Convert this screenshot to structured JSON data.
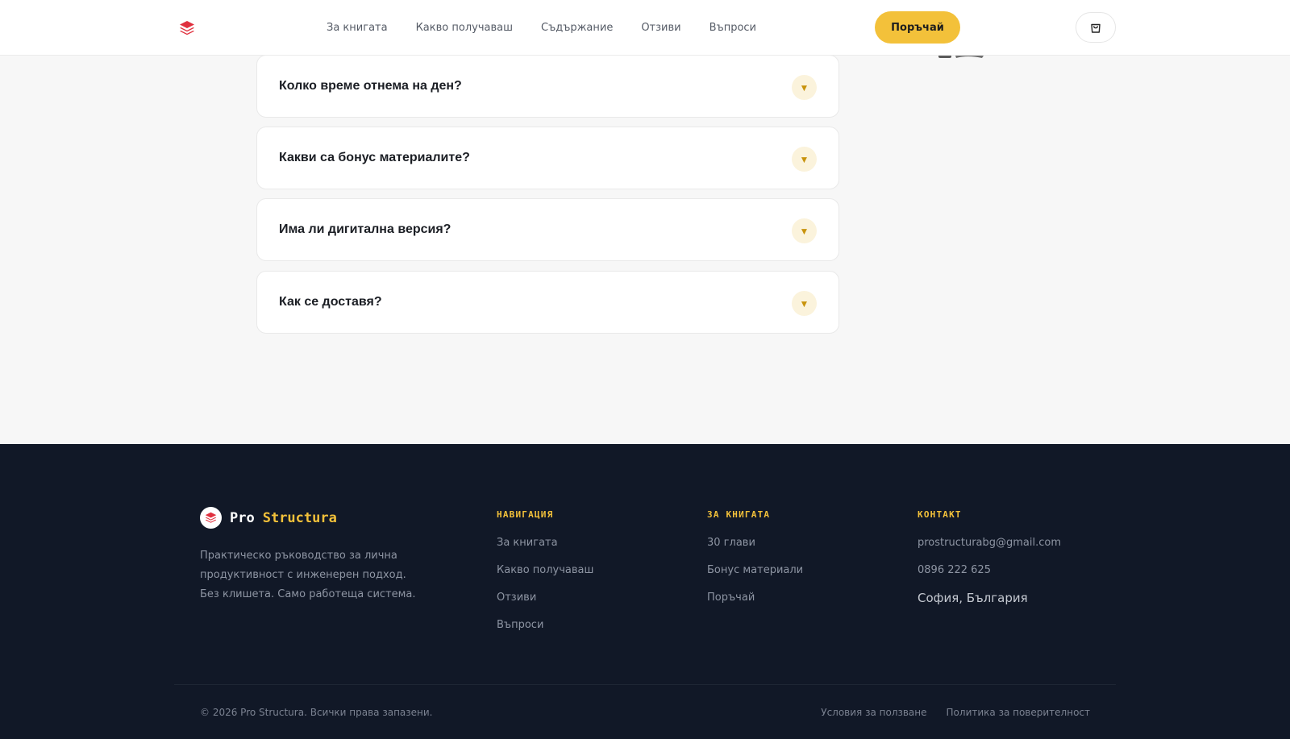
{
  "header": {
    "logo_icon": "layers-icon",
    "nav": [
      {
        "label": "За книгата"
      },
      {
        "label": "Какво получаваш"
      },
      {
        "label": "Съдържание"
      },
      {
        "label": "Отзиви"
      },
      {
        "label": "Въпроси"
      }
    ],
    "order_label": "Поръчай",
    "cart_icon": "shopping-bag-icon"
  },
  "faq": {
    "items": [
      {
        "question": "Колко време отнема на ден?",
        "toggle": "▼"
      },
      {
        "question": "Какви са бонус материалите?",
        "toggle": "▼"
      },
      {
        "question": "Има ли дигитална версия?",
        "toggle": "▼"
      },
      {
        "question": "Как се доставя?",
        "toggle": "▼"
      }
    ]
  },
  "footer": {
    "brand": {
      "pro": "Pro",
      "structura": "Structura"
    },
    "description": "Практическо ръководство за лична продуктивност с инженерен подход. Без клишета. Само работеща система.",
    "navigation": {
      "title": "НАВИГАЦИЯ",
      "links": [
        "За книгата",
        "Какво получаваш",
        "Отзиви",
        "Въпроси"
      ]
    },
    "book": {
      "title": "ЗА КНИГАТА",
      "links": [
        "30 глави",
        "Бонус материали",
        "Поръчай"
      ]
    },
    "contact": {
      "title": "КОНТАКТ",
      "email": "prostructurabg@gmail.com",
      "phone": "0896 222 625",
      "city": "София, България"
    },
    "copyright": "© 2026 Pro Structura. Всички права запазени.",
    "legal": [
      "Условия за ползване",
      "Политика за поверителност"
    ]
  },
  "colors": {
    "accent": "#f3c13a",
    "brand_red": "#e0313f",
    "footer_bg": "#111827"
  }
}
